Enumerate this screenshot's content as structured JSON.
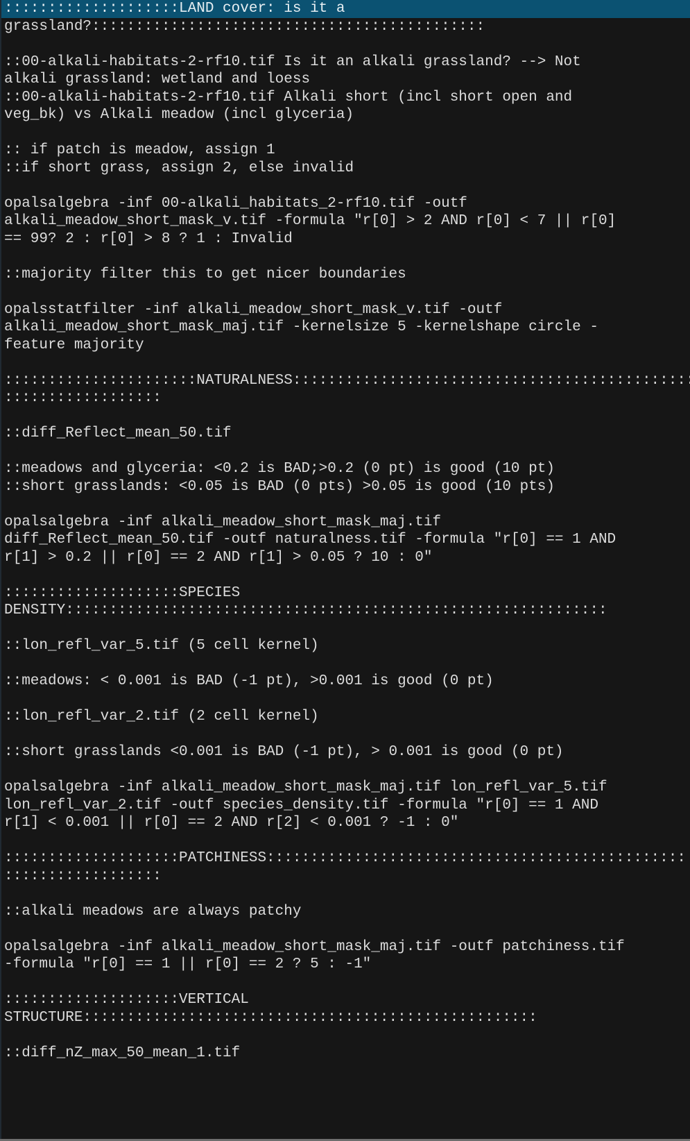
{
  "editor": {
    "selected_line_index": 0,
    "lines": [
      "::::::::::::::::::::LAND cover: is it a",
      "grassland?:::::::::::::::::::::::::::::::::::::::::::::",
      "",
      "::00-alkali-habitats-2-rf10.tif Is it an alkali grassland? --> Not",
      "alkali grassland: wetland and loess",
      "::00-alkali-habitats-2-rf10.tif Alkali short (incl short open and",
      "veg_bk) vs Alkali meadow (incl glyceria)",
      "",
      ":: if patch is meadow, assign 1",
      "::if short grass, assign 2, else invalid",
      "",
      "opalsalgebra -inf 00-alkali_habitats_2-rf10.tif -outf",
      "alkali_meadow_short_mask_v.tif -formula \"r[0] > 2 AND r[0] < 7 || r[0]",
      "== 99? 2 : r[0] > 8 ? 1 : Invalid",
      "",
      "::majority filter this to get nicer boundaries",
      "",
      "opalsstatfilter -inf alkali_meadow_short_mask_v.tif -outf",
      "alkali_meadow_short_mask_maj.tif -kernelsize 5 -kernelshape circle -",
      "feature majority",
      "",
      "::::::::::::::::::::::NATURALNESS::::::::::::::::::::::::::::::::::::::::::::::",
      "::::::::::::::::::",
      "",
      "::diff_Reflect_mean_50.tif",
      "",
      "::meadows and glyceria: <0.2 is BAD;>0.2 (0 pt) is good (10 pt)",
      "::short grasslands: <0.05 is BAD (0 pts) >0.05 is good (10 pts)",
      "",
      "opalsalgebra -inf alkali_meadow_short_mask_maj.tif",
      "diff_Reflect_mean_50.tif -outf naturalness.tif -formula \"r[0] == 1 AND",
      "r[1] > 0.2 || r[0] == 2 AND r[1] > 0.05 ? 10 : 0\"",
      "",
      "::::::::::::::::::::SPECIES",
      "DENSITY::::::::::::::::::::::::::::::::::::::::::::::::::::::::::::::",
      "",
      "::lon_refl_var_5.tif (5 cell kernel)",
      "",
      "::meadows: < 0.001 is BAD (-1 pt), >0.001 is good (0 pt)",
      "",
      "::lon_refl_var_2.tif (2 cell kernel)",
      "",
      "::short grasslands <0.001 is BAD (-1 pt), > 0.001 is good (0 pt)",
      "",
      "opalsalgebra -inf alkali_meadow_short_mask_maj.tif lon_refl_var_5.tif",
      "lon_refl_var_2.tif -outf species_density.tif -formula \"r[0] == 1 AND",
      "r[1] < 0.001 || r[0] == 2 AND r[2] < 0.001 ? -1 : 0\"",
      "",
      "::::::::::::::::::::PATCHINESS::::::::::::::::::::::::::::::::::::::::::::::::",
      "::::::::::::::::::",
      "",
      "::alkali meadows are always patchy",
      "",
      "opalsalgebra -inf alkali_meadow_short_mask_maj.tif -outf patchiness.tif",
      "-formula \"r[0] == 1 || r[0] == 2 ? 5 : -1\"",
      "",
      "::::::::::::::::::::VERTICAL",
      "STRUCTURE::::::::::::::::::::::::::::::::::::::::::::::::::::",
      "",
      "::diff_nZ_max_50_mean_1.tif",
      "",
      ""
    ]
  },
  "colors": {
    "background": "#161616",
    "text": "#dcdcdc",
    "selection": "#0b5272",
    "bottom_bar": "#6e6e6e"
  }
}
